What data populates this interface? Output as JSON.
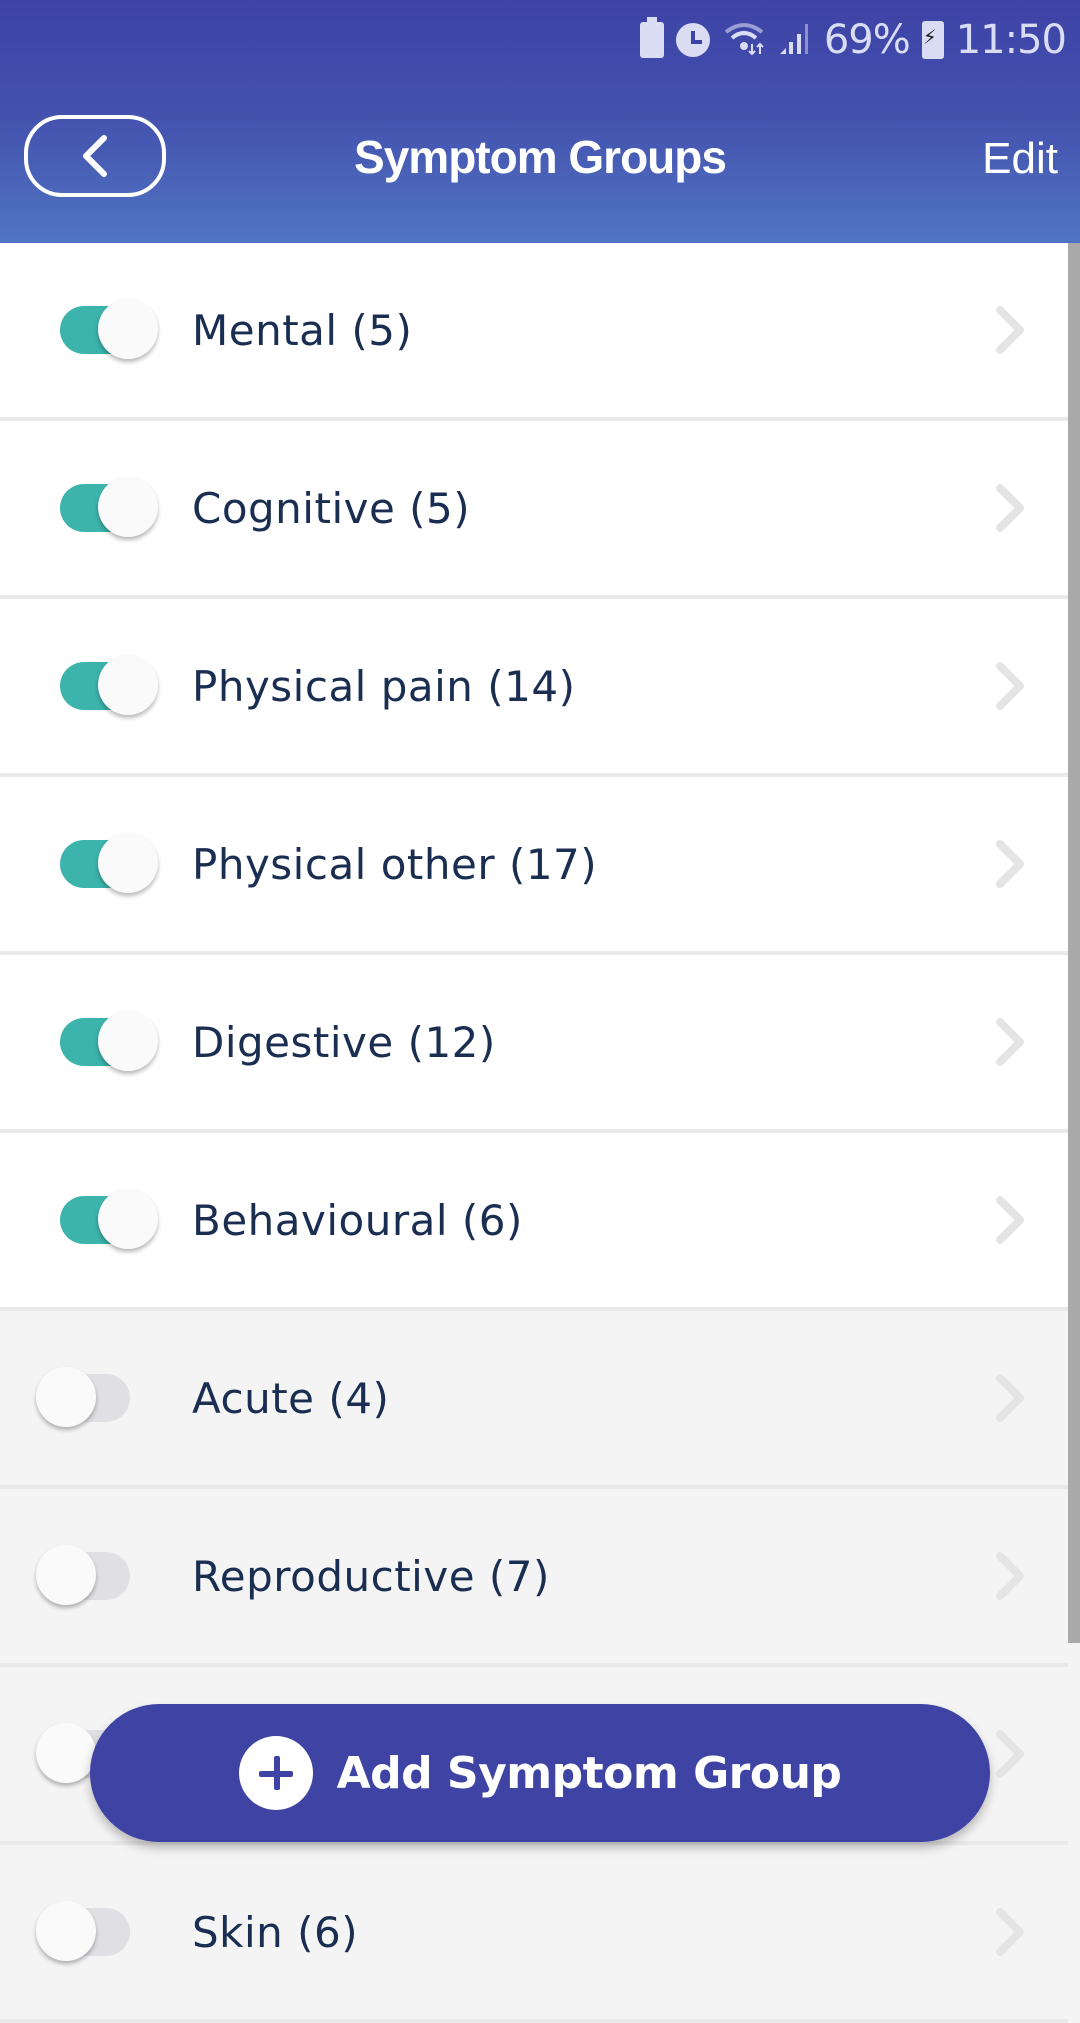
{
  "status_bar": {
    "battery_percent": "69%",
    "time": "11:50",
    "icons": [
      "battery-saver-icon",
      "alarm-icon",
      "wifi-icon",
      "signal-icon",
      "charging-battery-icon"
    ]
  },
  "header": {
    "title": "Symptom Groups",
    "back_icon": "chevron-left-icon",
    "edit_label": "Edit"
  },
  "groups": [
    {
      "label": "Mental (5)",
      "enabled": true
    },
    {
      "label": "Cognitive (5)",
      "enabled": true
    },
    {
      "label": "Physical pain (14)",
      "enabled": true
    },
    {
      "label": "Physical other (17)",
      "enabled": true
    },
    {
      "label": "Digestive (12)",
      "enabled": true
    },
    {
      "label": "Behavioural (6)",
      "enabled": true
    },
    {
      "label": "Acute (4)",
      "enabled": false
    },
    {
      "label": "Reproductive (7)",
      "enabled": false
    },
    {
      "label": "",
      "enabled": false
    },
    {
      "label": "Skin (6)",
      "enabled": false
    }
  ],
  "add_button": {
    "label": "Add Symptom Group",
    "icon": "plus-circle-icon"
  },
  "colors": {
    "header_top": "#3d43a6",
    "header_bottom": "#5074c2",
    "toggle_on": "#3cb3ab",
    "toggle_off": "#e0e0e4",
    "text": "#1a2e52",
    "button": "#3e43a4"
  }
}
